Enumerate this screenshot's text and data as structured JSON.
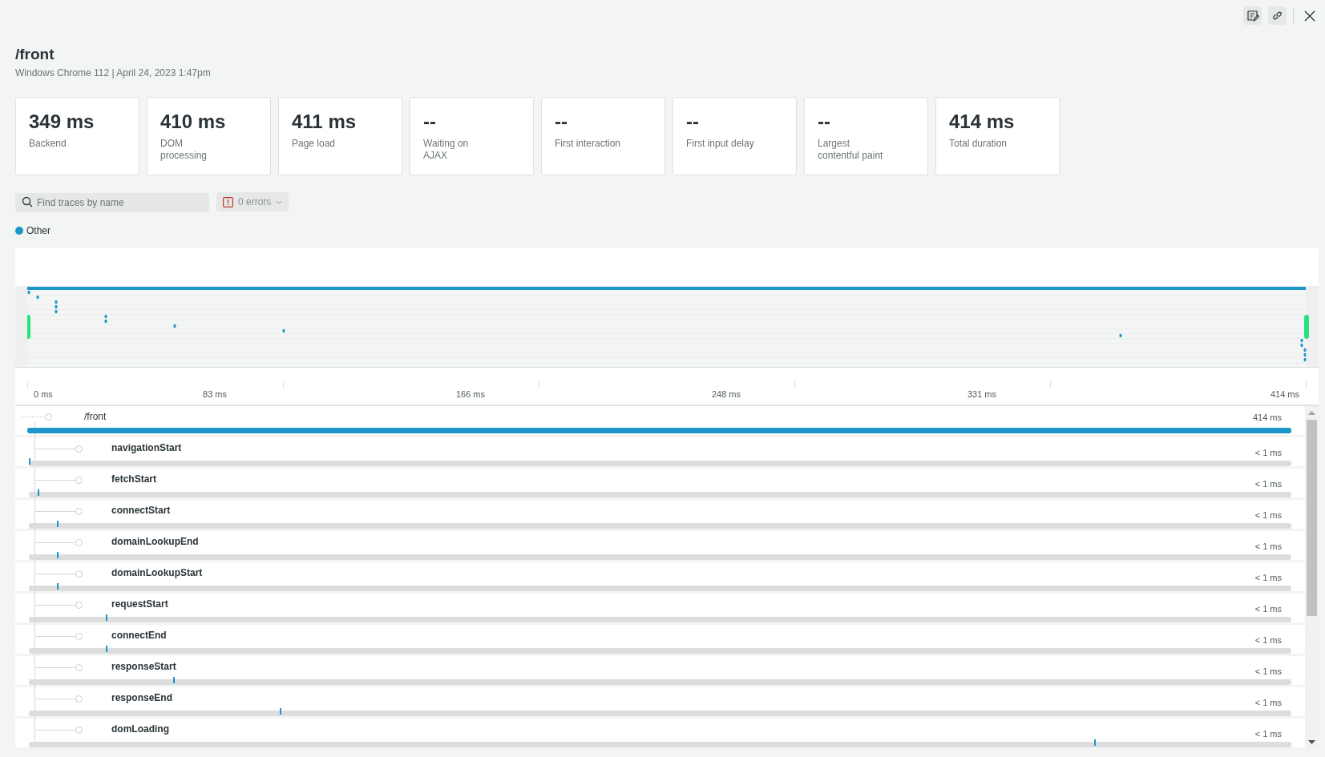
{
  "title": "/front",
  "subtitle": "Windows Chrome 112 | April 24, 2023 1:47pm",
  "metrics": [
    {
      "value": "349 ms",
      "label": "Backend"
    },
    {
      "value": "410 ms",
      "label": "DOM\nprocessing"
    },
    {
      "value": "411 ms",
      "label": "Page load"
    },
    {
      "value": "--",
      "label": "Waiting on\nAJAX"
    },
    {
      "value": "--",
      "label": "First interaction"
    },
    {
      "value": "--",
      "label": "First input delay"
    },
    {
      "value": "--",
      "label": "Largest\ncontentful paint"
    },
    {
      "value": "414 ms",
      "label": "Total duration"
    }
  ],
  "search": {
    "placeholder": "Find traces by name"
  },
  "errors_button": "0 errors",
  "legend": [
    {
      "label": "Other",
      "color": "#1a96c9"
    }
  ],
  "axis_labels": [
    "0 ms",
    "83 ms",
    "166 ms",
    "248 ms",
    "331 ms",
    "414 ms"
  ],
  "root": {
    "name": "/front",
    "duration": "414 ms",
    "level": 1,
    "children": [
      {
        "name": "navigationStart",
        "duration": "< 1 ms",
        "level": 0.0
      },
      {
        "name": "fetchStart",
        "duration": "< 1 ms",
        "level": 0.007
      },
      {
        "name": "connectStart",
        "duration": "< 1 ms",
        "level": 0.022
      },
      {
        "name": "domainLookupEnd",
        "duration": "< 1 ms",
        "level": 0.022
      },
      {
        "name": "domainLookupStart",
        "duration": "< 1 ms",
        "level": 0.022
      },
      {
        "name": "requestStart",
        "duration": "< 1 ms",
        "level": 0.061
      },
      {
        "name": "connectEnd",
        "duration": "< 1 ms",
        "level": 0.061
      },
      {
        "name": "responseStart",
        "duration": "< 1 ms",
        "level": 0.114
      },
      {
        "name": "responseEnd",
        "duration": "< 1 ms",
        "level": 0.199
      },
      {
        "name": "domLoading",
        "duration": "< 1 ms",
        "level": 0.844
      }
    ]
  }
}
